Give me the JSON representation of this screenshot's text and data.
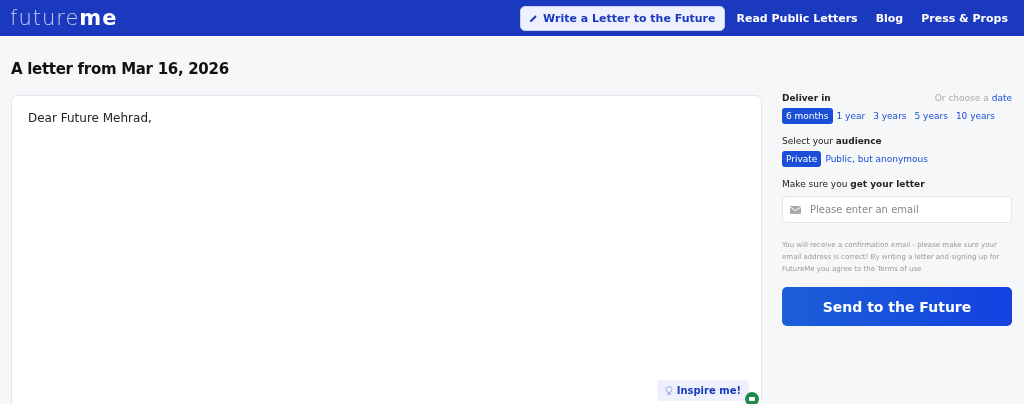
{
  "logo": "future**me**",
  "nav": [
    {
      "label": "Write a Letter to the Future",
      "selected": true
    },
    {
      "label": "Read Public Letters",
      "selected": false
    },
    {
      "label": "Blog",
      "selected": false
    },
    {
      "label": "Press & Props",
      "selected": false
    }
  ],
  "heading": "A letter from Mar 16, 2026",
  "letter": {
    "value": "Dear Future Mehrad,",
    "inspire": "Inspire me!"
  },
  "deliver": {
    "label": "Deliver in",
    "hint": "Or choose a",
    "link": "date",
    "options": [
      {
        "label": "6 months",
        "selected": true
      },
      {
        "label": "1 year",
        "selected": false
      },
      {
        "label": "3 years",
        "selected": false
      },
      {
        "label": "5 years",
        "selected": false
      },
      {
        "label": "10 years",
        "selected": false
      }
    ]
  },
  "audience": {
    "label": "Select your **audience**",
    "options": [
      {
        "label": "Private",
        "selected": true
      },
      {
        "label": "Public, but anonymous",
        "selected": false
      }
    ]
  },
  "email": {
    "label": "Make sure you **get your letter**",
    "placeholder": "Please enter an email"
  },
  "notice": "You will receive a confirmation email - please make sure your email address is correct! By writing a letter and signing up for FutureMe you agree to the Terms of use",
  "submit": "Send to the Future"
}
